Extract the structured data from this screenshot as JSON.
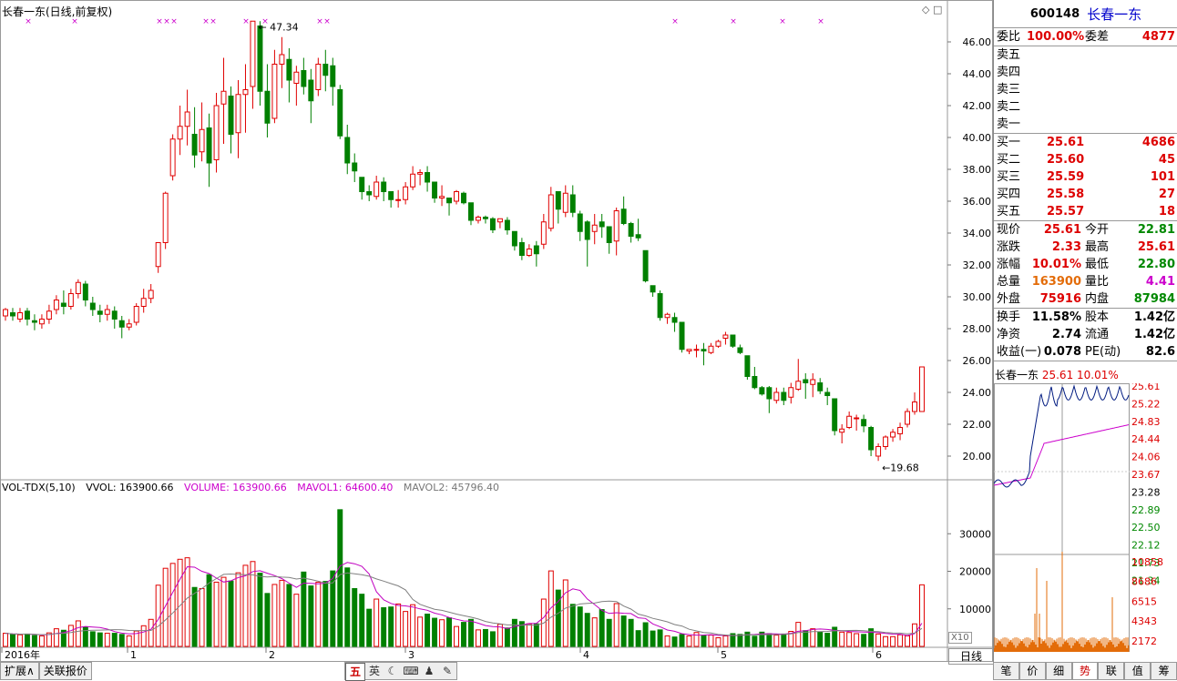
{
  "chart_title": "长春一东(日线,前复权)",
  "high_label": "47.34",
  "low_label": "19.68",
  "price_axis": [
    "46.00",
    "44.00",
    "42.00",
    "40.00",
    "38.00",
    "36.00",
    "34.00",
    "32.00",
    "30.00",
    "28.00",
    "26.00",
    "24.00",
    "22.00",
    "20.00"
  ],
  "vol_axis": [
    "30000",
    "20000",
    "10000"
  ],
  "volume_legend": {
    "name": "VOL-TDX(5,10)",
    "vvol": "VVOL: 163900.66",
    "volume": "VOLUME: 163900.66",
    "mavol1": "MAVOL1: 64600.40",
    "mavol2": "MAVOL2: 45796.40"
  },
  "x_labels": [
    "2016年",
    "1",
    "2",
    "3",
    "4",
    "5",
    "6"
  ],
  "x10_label": "X10",
  "period_label": "日线",
  "colors": {
    "up": "#e00000",
    "down": "#008000",
    "ma1": "#c000c0",
    "ma2": "#808080",
    "grid": "#d8d8d8"
  },
  "chart_data": {
    "type": "candlestick",
    "title": "长春一东(日线,前复权)",
    "ylim": [
      19,
      48
    ],
    "candles": [
      [
        28.8,
        29.2,
        28.5,
        29.3
      ],
      [
        29.0,
        28.8,
        28.5,
        29.3
      ],
      [
        28.6,
        29.0,
        28.4,
        29.3
      ],
      [
        29.1,
        28.6,
        28.2,
        29.3
      ],
      [
        28.5,
        28.4,
        27.9,
        28.9
      ],
      [
        28.3,
        28.6,
        28.0,
        28.9
      ],
      [
        28.6,
        29.1,
        28.3,
        29.5
      ],
      [
        29.2,
        29.8,
        28.9,
        30.1
      ],
      [
        29.6,
        29.4,
        28.9,
        30.4
      ],
      [
        29.4,
        30.2,
        29.2,
        30.5
      ],
      [
        30.2,
        30.9,
        29.9,
        31.1
      ],
      [
        30.8,
        29.8,
        29.4,
        31.0
      ],
      [
        29.6,
        29.2,
        28.8,
        30.0
      ],
      [
        29.1,
        28.9,
        28.4,
        29.5
      ],
      [
        28.9,
        29.2,
        28.5,
        29.5
      ],
      [
        29.1,
        28.6,
        28.0,
        29.4
      ],
      [
        28.5,
        28.1,
        27.4,
        28.8
      ],
      [
        28.1,
        28.3,
        27.9,
        28.6
      ],
      [
        28.4,
        29.4,
        28.2,
        29.6
      ],
      [
        29.4,
        29.9,
        29.0,
        30.5
      ],
      [
        29.9,
        30.4,
        29.6,
        30.8
      ],
      [
        31.9,
        33.4,
        31.5,
        33.4
      ],
      [
        33.4,
        36.5,
        33.0,
        36.6
      ],
      [
        37.6,
        39.9,
        37.3,
        40.2
      ],
      [
        39.9,
        40.7,
        38.9,
        42.0
      ],
      [
        40.7,
        41.6,
        39.5,
        43.0
      ],
      [
        40.2,
        38.9,
        38.1,
        41.9
      ],
      [
        39.1,
        40.5,
        38.5,
        42.2
      ],
      [
        40.6,
        38.4,
        36.9,
        41.5
      ],
      [
        38.6,
        42.0,
        37.8,
        42.8
      ],
      [
        42.1,
        42.9,
        39.6,
        45.0
      ],
      [
        42.6,
        40.2,
        39.0,
        43.2
      ],
      [
        40.3,
        42.7,
        38.7,
        43.6
      ],
      [
        42.7,
        43.0,
        40.3,
        44.6
      ],
      [
        43.2,
        47.3,
        41.8,
        47.3
      ],
      [
        47.0,
        42.9,
        42.0,
        47.3
      ],
      [
        42.9,
        40.9,
        40.0,
        44.6
      ],
      [
        41.2,
        44.6,
        40.9,
        45.5
      ],
      [
        44.6,
        45.2,
        43.1,
        46.3
      ],
      [
        44.9,
        43.6,
        42.2,
        45.6
      ],
      [
        43.4,
        44.1,
        42.0,
        44.5
      ],
      [
        44.2,
        43.2,
        42.7,
        45.0
      ],
      [
        43.6,
        42.3,
        40.9,
        44.3
      ],
      [
        43.0,
        44.6,
        42.6,
        45.0
      ],
      [
        44.6,
        43.9,
        42.9,
        45.5
      ],
      [
        44.5,
        43.2,
        42.0,
        45.0
      ],
      [
        43.0,
        40.1,
        39.9,
        43.3
      ],
      [
        40.0,
        38.4,
        37.7,
        40.8
      ],
      [
        38.4,
        37.9,
        37.2,
        39.0
      ],
      [
        37.5,
        36.6,
        36.1,
        37.5
      ],
      [
        36.6,
        36.4,
        36.0,
        37.0
      ],
      [
        36.3,
        37.2,
        36.1,
        37.6
      ],
      [
        37.2,
        36.6,
        36.0,
        37.5
      ],
      [
        36.6,
        36.1,
        35.6,
        36.6
      ],
      [
        36.1,
        36.1,
        35.6,
        36.7
      ],
      [
        36.1,
        36.9,
        35.8,
        37.2
      ],
      [
        36.9,
        37.7,
        36.7,
        38.2
      ],
      [
        37.7,
        37.8,
        37.0,
        38.0
      ],
      [
        37.8,
        37.2,
        36.6,
        38.2
      ],
      [
        37.2,
        36.2,
        35.9,
        37.2
      ],
      [
        36.2,
        36.3,
        35.7,
        37.0
      ],
      [
        36.2,
        35.9,
        35.1,
        36.2
      ],
      [
        36.0,
        36.6,
        35.8,
        36.7
      ],
      [
        36.5,
        35.9,
        35.8,
        36.6
      ],
      [
        35.9,
        34.8,
        34.5,
        35.9
      ],
      [
        34.8,
        35.0,
        34.6,
        35.1
      ],
      [
        35.0,
        34.9,
        34.6,
        35.1
      ],
      [
        34.9,
        34.2,
        34.0,
        35.0
      ],
      [
        34.7,
        34.9,
        34.3,
        34.9
      ],
      [
        34.8,
        34.2,
        33.9,
        35.0
      ],
      [
        34.1,
        33.2,
        32.9,
        34.1
      ],
      [
        33.4,
        32.6,
        32.3,
        33.7
      ],
      [
        32.6,
        33.0,
        32.5,
        33.3
      ],
      [
        33.2,
        32.7,
        31.9,
        33.5
      ],
      [
        33.3,
        34.7,
        33.0,
        35.2
      ],
      [
        34.3,
        36.4,
        34.1,
        36.9
      ],
      [
        36.6,
        35.5,
        34.6,
        36.6
      ],
      [
        35.3,
        36.5,
        35.0,
        37.0
      ],
      [
        36.4,
        35.3,
        35.0,
        37.0
      ],
      [
        35.2,
        34.1,
        33.5,
        35.4
      ],
      [
        34.7,
        33.6,
        31.9,
        34.8
      ],
      [
        34.1,
        34.5,
        33.3,
        35.2
      ],
      [
        34.7,
        34.4,
        33.7,
        35.2
      ],
      [
        34.4,
        33.4,
        32.7,
        34.4
      ],
      [
        33.5,
        35.4,
        32.6,
        35.6
      ],
      [
        35.5,
        34.6,
        34.5,
        36.3
      ],
      [
        34.6,
        33.8,
        33.4,
        34.7
      ],
      [
        33.9,
        33.7,
        33.5,
        34.9
      ],
      [
        32.9,
        31.0,
        30.9,
        32.9
      ],
      [
        30.7,
        30.3,
        30.0,
        30.7
      ],
      [
        30.2,
        28.7,
        28.5,
        30.4
      ],
      [
        28.7,
        28.9,
        28.3,
        29.0
      ],
      [
        28.7,
        28.4,
        27.8,
        29.0
      ],
      [
        28.4,
        26.7,
        26.5,
        28.4
      ],
      [
        26.6,
        26.7,
        26.4,
        26.7
      ],
      [
        26.7,
        26.7,
        26.2,
        27.0
      ],
      [
        26.7,
        26.6,
        25.7,
        27.1
      ],
      [
        26.5,
        26.9,
        26.4,
        27.1
      ],
      [
        26.9,
        27.2,
        26.8,
        27.3
      ],
      [
        27.4,
        27.6,
        27.0,
        27.8
      ],
      [
        27.6,
        26.9,
        26.8,
        27.6
      ],
      [
        26.8,
        26.5,
        26.4,
        27.0
      ],
      [
        26.3,
        25.0,
        24.8,
        26.3
      ],
      [
        25.0,
        24.3,
        24.2,
        25.6
      ],
      [
        24.3,
        23.9,
        23.8,
        24.4
      ],
      [
        24.3,
        23.6,
        22.7,
        24.4
      ],
      [
        23.5,
        24.0,
        23.3,
        24.3
      ],
      [
        24.0,
        23.5,
        23.2,
        24.3
      ],
      [
        23.7,
        24.3,
        23.3,
        24.6
      ],
      [
        24.2,
        24.7,
        24.1,
        26.1
      ],
      [
        24.8,
        24.6,
        23.6,
        25.2
      ],
      [
        24.5,
        24.8,
        23.7,
        25.2
      ],
      [
        24.6,
        24.1,
        23.9,
        24.9
      ],
      [
        24.0,
        23.8,
        23.2,
        24.3
      ],
      [
        23.6,
        21.6,
        21.3,
        23.6
      ],
      [
        21.5,
        21.7,
        20.8,
        22.0
      ],
      [
        21.8,
        22.5,
        21.7,
        22.8
      ],
      [
        22.4,
        22.4,
        21.6,
        22.6
      ],
      [
        22.3,
        21.9,
        21.5,
        22.6
      ],
      [
        21.8,
        20.4,
        20.0,
        21.9
      ],
      [
        20.0,
        20.6,
        19.7,
        20.8
      ],
      [
        20.6,
        21.2,
        20.4,
        21.3
      ],
      [
        21.2,
        21.5,
        20.9,
        21.7
      ],
      [
        21.4,
        21.8,
        21.0,
        22.1
      ],
      [
        22.0,
        22.8,
        21.8,
        23.0
      ],
      [
        22.8,
        23.4,
        22.6,
        24.0
      ],
      [
        22.8,
        25.6,
        22.8,
        25.6
      ]
    ],
    "volume": [
      3500,
      3200,
      3100,
      3300,
      2900,
      2800,
      3600,
      4700,
      4300,
      5600,
      6800,
      5200,
      3900,
      3600,
      3500,
      3500,
      3200,
      2800,
      4100,
      5500,
      7200,
      16300,
      20800,
      22100,
      23200,
      23600,
      15700,
      15400,
      19100,
      17100,
      18400,
      17400,
      19600,
      21600,
      22600,
      19500,
      14100,
      16500,
      17600,
      16500,
      13900,
      19800,
      16100,
      17100,
      17300,
      20100,
      36400,
      20900,
      15400,
      13900,
      9900,
      12600,
      10300,
      10500,
      11300,
      9300,
      11100,
      7800,
      8600,
      7500,
      7100,
      7600,
      5300,
      6400,
      7200,
      4400,
      4500,
      3900,
      5900,
      4900,
      7200,
      6600,
      6000,
      6000,
      12600,
      20100,
      15000,
      17700,
      11200,
      10500,
      8800,
      7600,
      9800,
      7200,
      11400,
      8100,
      7200,
      4200,
      6300,
      4100,
      4400,
      2800,
      2500,
      3200,
      2800,
      3700,
      2900,
      3000,
      2300,
      2800,
      3400,
      3200,
      3800,
      2700,
      3800,
      3400,
      3000,
      3300,
      4000,
      6400,
      4200,
      4700,
      3800,
      3500,
      5100,
      3800,
      3700,
      3400,
      3200,
      4700,
      3300,
      2600,
      2600,
      3100,
      2800,
      6000,
      16400
    ]
  },
  "quote": {
    "code": "600148",
    "name": "长春一东",
    "weibi_label": "委比",
    "weibi": "100.00%",
    "weicha_label": "委差",
    "weicha": "4877",
    "sells": [
      "卖五",
      "卖四",
      "卖三",
      "卖二",
      "卖一"
    ],
    "buys": [
      {
        "label": "买一",
        "price": "25.61",
        "vol": "4686"
      },
      {
        "label": "买二",
        "price": "25.60",
        "vol": "45"
      },
      {
        "label": "买三",
        "price": "25.59",
        "vol": "101"
      },
      {
        "label": "买四",
        "price": "25.58",
        "vol": "27"
      },
      {
        "label": "买五",
        "price": "25.57",
        "vol": "18"
      }
    ],
    "stats1": [
      {
        "l": "现价",
        "v": "25.61",
        "l2": "今开",
        "v2": "22.81"
      },
      {
        "l": "涨跌",
        "v": "2.33",
        "l2": "最高",
        "v2": "25.61"
      },
      {
        "l": "涨幅",
        "v": "10.01%",
        "l2": "最低",
        "v2": "22.80"
      },
      {
        "l": "总量",
        "v": "163900",
        "l2": "量比",
        "v2": "4.41"
      },
      {
        "l": "外盘",
        "v": "75916",
        "l2": "内盘",
        "v2": "87984"
      }
    ],
    "stats2": [
      {
        "l": "换手",
        "v": "11.58%",
        "l2": "股本",
        "v2": "1.42亿"
      },
      {
        "l": "净资",
        "v": "2.74",
        "l2": "流通",
        "v2": "1.42亿"
      },
      {
        "l": "收益(一)",
        "v": "0.078",
        "l2": "PE(动)",
        "v2": "82.6"
      }
    ],
    "mini_name": "长春一东",
    "mini_price": "25.61",
    "mini_pct": "10.01%",
    "mini_price_axis": [
      "25.61",
      "25.22",
      "24.83",
      "24.44",
      "24.06",
      "23.67",
      "23.28",
      "22.89",
      "22.50",
      "22.12",
      "21.73",
      "21.34"
    ],
    "mini_vol_axis": [
      "10858",
      "8686",
      "6515",
      "4343",
      "2172"
    ]
  },
  "bottom_tabs": [
    "扩展∧",
    "关联报价"
  ],
  "toolbar_icons": [
    "五",
    "英",
    "moon-icon",
    "keyboard-icon",
    "person-icon",
    "wrench-icon"
  ],
  "right_tabs": [
    "笔",
    "价",
    "细",
    "势",
    "联",
    "值",
    "筹"
  ]
}
